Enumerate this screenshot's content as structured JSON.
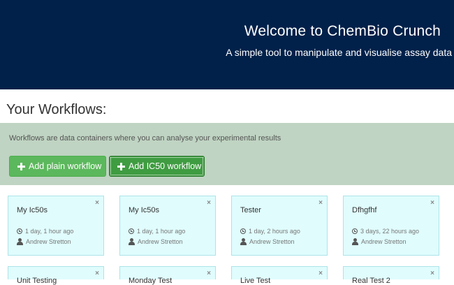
{
  "header": {
    "title": "Welcome to ChemBio Crunch",
    "subtitle": "A simple tool to manipulate and visualise assay data"
  },
  "workflows": {
    "heading": "Your Workflows:",
    "description": "Workflows are data containers where you can analyse your experimental results",
    "add_plain_label": "Add plain workflow",
    "add_ic50_label": "Add IC50 workflow",
    "close_glyph": "×",
    "cards": [
      {
        "name": "My Ic50s",
        "time": "1 day, 1 hour ago",
        "user": "Andrew Stretton"
      },
      {
        "name": "My Ic50s",
        "time": "1 day, 1 hour ago",
        "user": "Andrew Stretton"
      },
      {
        "name": "Tester",
        "time": "1 day, 2 hours ago",
        "user": "Andrew Stretton"
      },
      {
        "name": "Dfhgfhf",
        "time": "3 days, 22 hours ago",
        "user": "Andrew Stretton"
      },
      {
        "name": "Unit Testing",
        "time": "",
        "user": ""
      },
      {
        "name": "Monday Test",
        "time": "",
        "user": ""
      },
      {
        "name": "Live Test",
        "time": "",
        "user": ""
      },
      {
        "name": "Real Test 2",
        "time": "",
        "user": ""
      }
    ]
  },
  "colors": {
    "header_bg": "#01214a",
    "well_bg": "#bfd4c2",
    "button_green": "#5cb85c",
    "card_bg": "#e0fcfd"
  },
  "icons": {
    "add": "plus-icon",
    "time": "clock-icon",
    "user": "user-icon",
    "remove": "close-icon"
  }
}
